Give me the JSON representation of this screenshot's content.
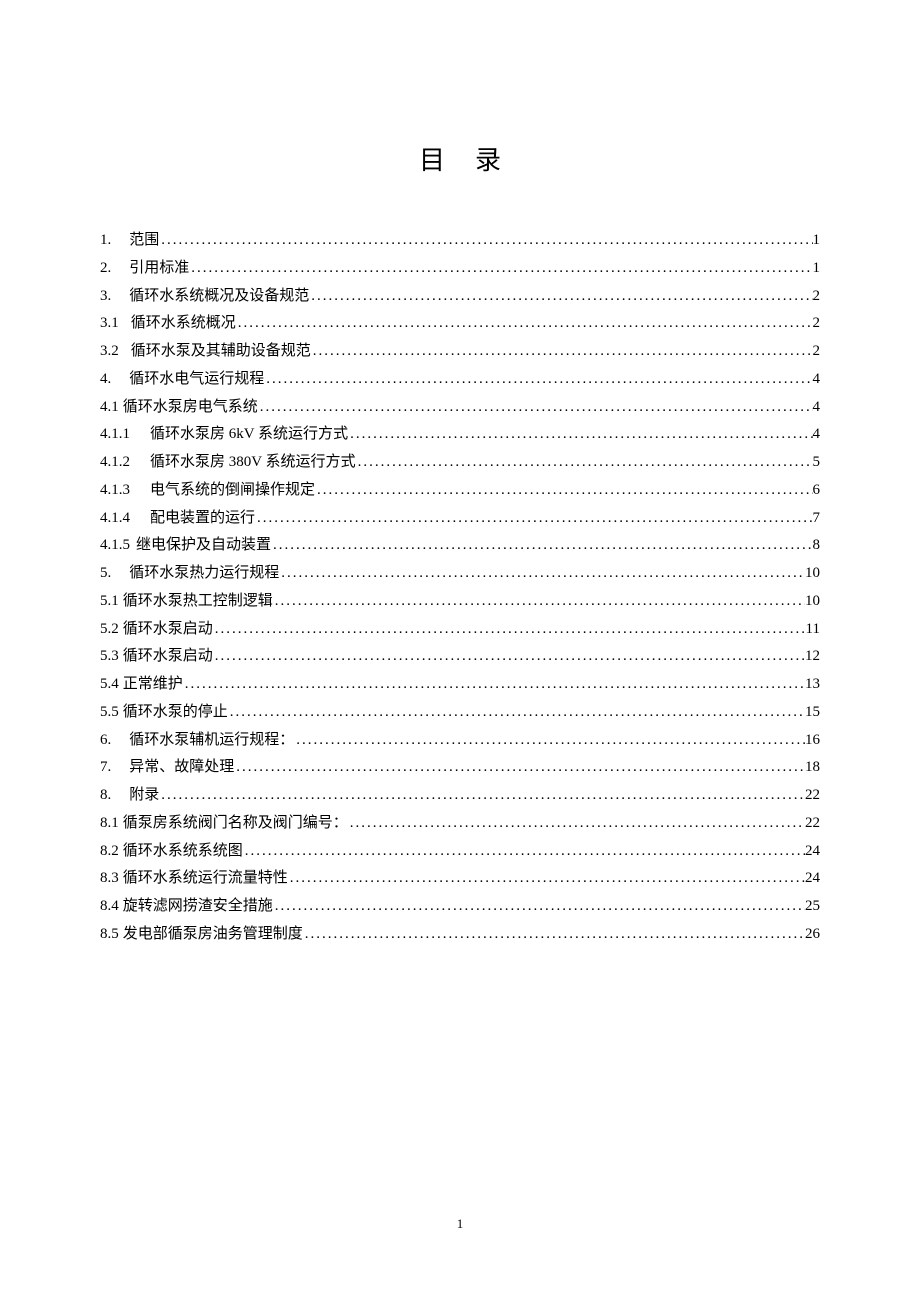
{
  "title": "目录",
  "pageNumber": "1",
  "entries": [
    {
      "num": "1.",
      "text": "范围",
      "page": "1",
      "cls": "indent-1"
    },
    {
      "num": "2.",
      "text": "引用标准",
      "page": "1",
      "cls": "indent-1"
    },
    {
      "num": "3.",
      "text": "循环水系统概况及设备规范",
      "page": "2",
      "cls": "indent-1"
    },
    {
      "num": "3.1",
      "text": "循环水系统概况",
      "page": "2",
      "cls": "indent-2"
    },
    {
      "num": "3.2",
      "text": "循环水泵及其辅助设备规范",
      "page": "2",
      "cls": "indent-2"
    },
    {
      "num": "4.",
      "text": "循环水电气运行规程",
      "page": "4",
      "cls": "indent-1"
    },
    {
      "num": "4.1",
      "text": "循环水泵房电气系统",
      "page": "4",
      "cls": "tight"
    },
    {
      "num": "4.1.1",
      "text": "循环水泵房 6kV 系统运行方式",
      "page": "4",
      "cls": "indent-3"
    },
    {
      "num": "4.1.2",
      "text": "循环水泵房 380V 系统运行方式",
      "page": "5",
      "cls": "indent-3"
    },
    {
      "num": "4.1.3",
      "text": "电气系统的倒闸操作规定",
      "page": "6",
      "cls": "indent-3"
    },
    {
      "num": "4.1.4",
      "text": "配电装置的运行",
      "page": "7",
      "cls": "indent-3"
    },
    {
      "num": "4.1.5",
      "text": "继电保护及自动装置",
      "page": "8",
      "cls": "indent-3b"
    },
    {
      "num": "5.",
      "text": "循环水泵热力运行规程",
      "page": "10",
      "cls": "indent-1"
    },
    {
      "num": "5.1",
      "text": "循环水泵热工控制逻辑",
      "page": "10",
      "cls": "tight"
    },
    {
      "num": "5.2",
      "text": "循环水泵启动",
      "page": "11",
      "cls": "tight"
    },
    {
      "num": "5.3",
      "text": "循环水泵启动",
      "page": "12",
      "cls": "tight"
    },
    {
      "num": "5.4",
      "text": "正常维护",
      "page": "13",
      "cls": "tight"
    },
    {
      "num": "5.5",
      "text": "循环水泵的停止",
      "page": "15",
      "cls": "tight"
    },
    {
      "num": "6.",
      "text": "循环水泵辅机运行规程：",
      "page": "16",
      "cls": "indent-1"
    },
    {
      "num": "7.",
      "text": "异常、故障处理",
      "page": "18",
      "cls": "indent-1"
    },
    {
      "num": "8.",
      "text": "附录",
      "page": "22",
      "cls": "indent-1"
    },
    {
      "num": "8.1",
      "text": "循泵房系统阀门名称及阀门编号：",
      "page": "22",
      "cls": "tight"
    },
    {
      "num": "8.2",
      "text": "循环水系统系统图",
      "page": "24",
      "cls": "tight"
    },
    {
      "num": "8.3",
      "text": "循环水系统运行流量特性",
      "page": "24",
      "cls": "tight"
    },
    {
      "num": "8.4",
      "text": "旋转滤网捞渣安全措施",
      "page": "25",
      "cls": "tight"
    },
    {
      "num": "8.5",
      "text": "发电部循泵房油务管理制度",
      "page": "26",
      "cls": "tight"
    }
  ]
}
